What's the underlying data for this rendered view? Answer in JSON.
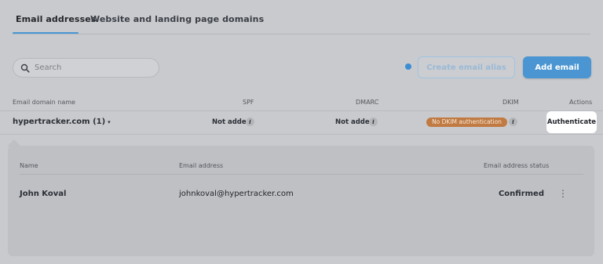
{
  "tabs": {
    "email_addresses": "Email addresses",
    "domains": "Website and landing page domains"
  },
  "search": {
    "placeholder": "Search"
  },
  "toolbar": {
    "create_alias_label": "Create email alias",
    "add_email_label": "Add email"
  },
  "table": {
    "headers": {
      "domain": "Email domain name",
      "spf": "SPF",
      "dmarc": "DMARC",
      "dkim": "DKIM",
      "actions": "Actions"
    },
    "row": {
      "domain": "hypertracker.com (1)",
      "caret": "▾",
      "spf": "Not added",
      "dmarc": "Not added",
      "dkim": "No DKIM authentication",
      "info_glyph": "i",
      "action": "Authenticate"
    }
  },
  "details": {
    "headers": {
      "name": "Name",
      "email": "Email address",
      "status": "Email address status"
    },
    "row": {
      "name": "John Koval",
      "email": "johnkoval@hypertracker.com",
      "status": "Confirmed",
      "menu_glyph": "⋮"
    }
  },
  "colors": {
    "accent": "#4b96d2",
    "dkim_badge": "#c07a42",
    "background": "#c9cacd"
  }
}
